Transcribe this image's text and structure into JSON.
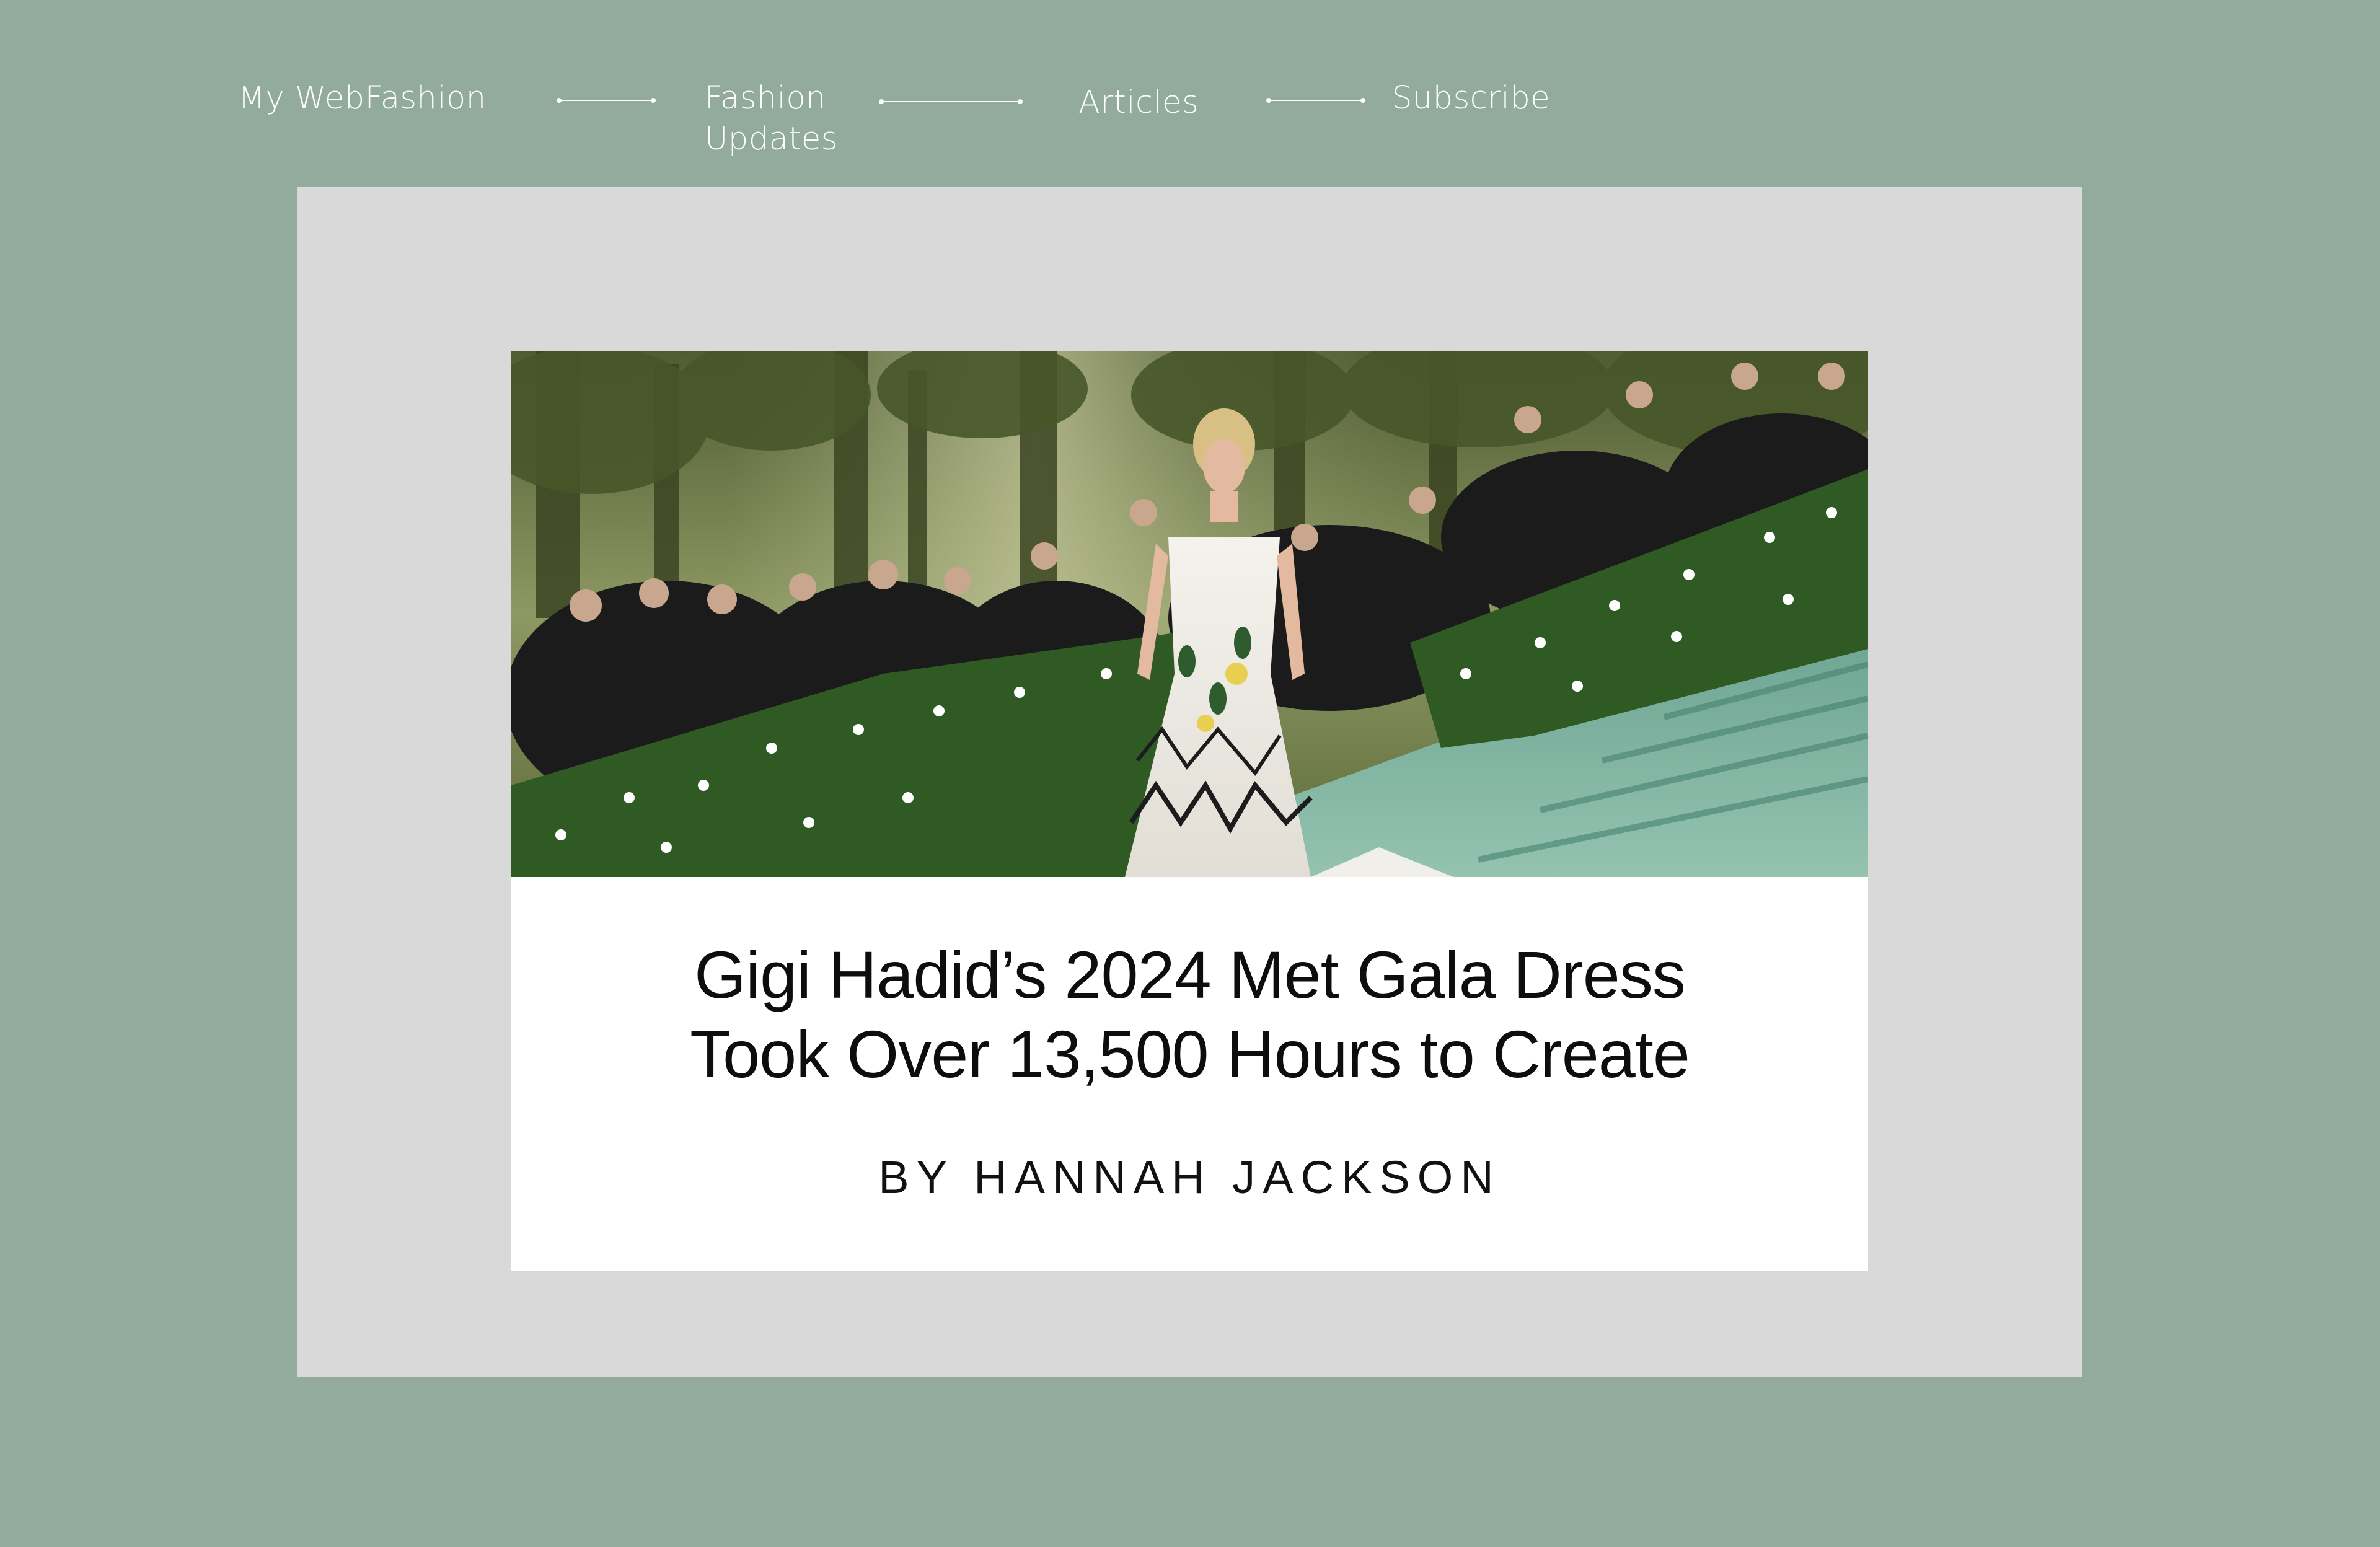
{
  "nav": {
    "brand": "My WebFashion",
    "items": [
      {
        "label": "Fashion\nUpdates"
      },
      {
        "label": "Articles"
      },
      {
        "label": "Subscribe"
      }
    ]
  },
  "article": {
    "headline": "Gigi Hadid’s 2024 Met Gala Dress\nTook Over 13,500 Hours to Create",
    "byline": "BY HANNAH JACKSON"
  },
  "colors": {
    "page_background": "#93ab9c",
    "frame_background": "#d9d9d9",
    "card_background": "#ffffff",
    "nav_text": "#ffffff"
  }
}
